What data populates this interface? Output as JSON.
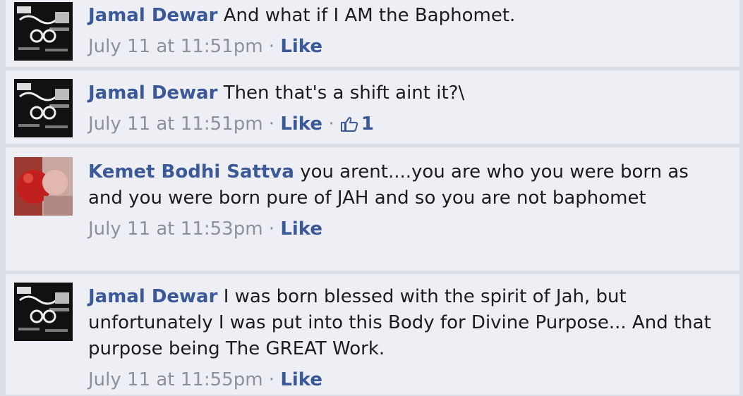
{
  "comments": [
    {
      "author": "Jamal Dewar",
      "text": "And what if I AM the Baphomet.",
      "timestamp": "July 11 at 11:51pm",
      "separator": "·",
      "like_label": "Like",
      "avatar": "band-poster-avatar"
    },
    {
      "author": "Jamal Dewar",
      "text": "Then that's a shift aint it?\\",
      "timestamp": "July 11 at 11:51pm",
      "separator": "·",
      "like_label": "Like",
      "separator2": "·",
      "like_count": "1",
      "avatar": "band-poster-avatar"
    },
    {
      "author": "Kemet Bodhi Sattva",
      "text": "you arent....you are who you were born as and you were born pure of JAH and so you are not baphomet",
      "timestamp": "July 11 at 11:53pm",
      "separator": "·",
      "like_label": "Like",
      "avatar": "red-photo-avatar"
    },
    {
      "author": "Jamal Dewar",
      "text": "I was born blessed with the spirit of Jah, but unfortunately I was put into this Body for Divine Purpose... And that purpose being The GREAT Work.",
      "timestamp": "July 11 at 11:55pm",
      "separator": "·",
      "like_label": "Like",
      "avatar": "band-poster-avatar"
    }
  ],
  "colors": {
    "author": "#3b5998",
    "comment_bg": "#edeff4",
    "meta": "#8d919b"
  }
}
